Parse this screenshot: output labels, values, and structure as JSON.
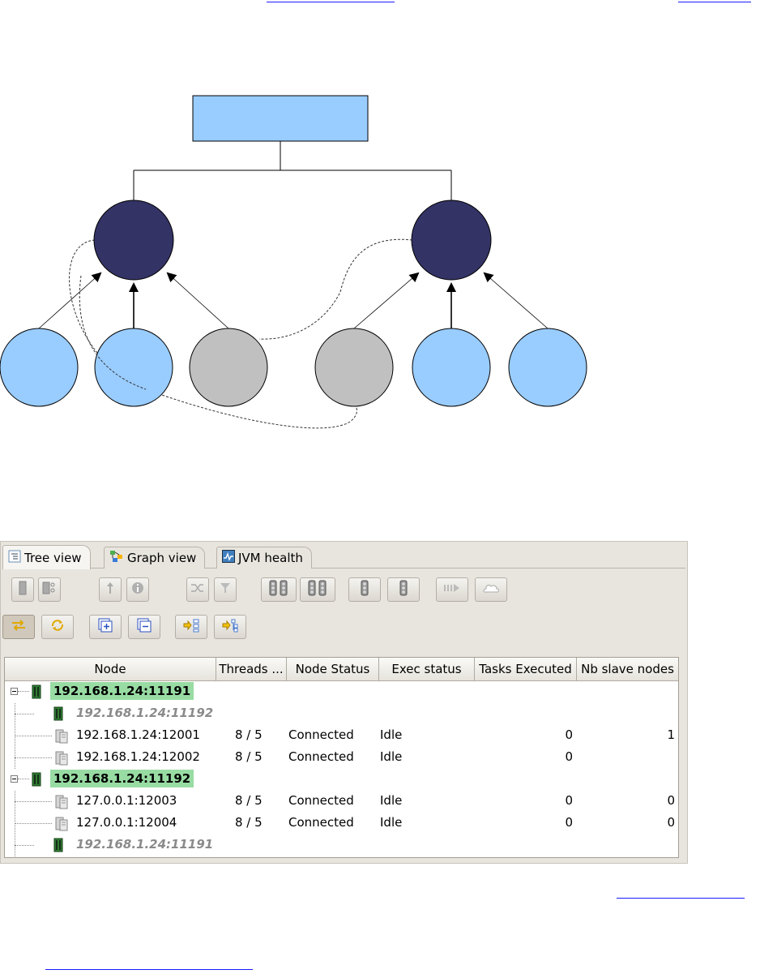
{
  "tabs": [
    {
      "label": "Tree view",
      "icon": "tree-view-icon",
      "active": true
    },
    {
      "label": "Graph view",
      "icon": "graph-view-icon",
      "active": false
    },
    {
      "label": "JVM health",
      "icon": "jvm-health-icon",
      "active": false
    }
  ],
  "toolbar": {
    "row1": [
      "server-icon",
      "server-settings-icon",
      "upload-icon",
      "info-icon",
      "shuffle-icon",
      "filter-icon",
      "traffic-light-pair-icon",
      "traffic-light-pair-icon",
      "traffic-light-icon",
      "traffic-light-icon",
      "play-forward-icon",
      "cloud-icon"
    ],
    "row2": [
      "swap-icon",
      "refresh-icon",
      "expand-all-icon",
      "collapse-all-icon",
      "select-drivers-icon",
      "select-nodes-icon"
    ]
  },
  "table": {
    "columns": [
      "Node",
      "Threads ...",
      "Node Status",
      "Exec status",
      "Tasks Executed",
      "Nb slave nodes"
    ],
    "rows": [
      {
        "level": 0,
        "kind": "driver",
        "name": "192.168.1.24:11191",
        "threads": "",
        "node_status": "",
        "exec_status": "",
        "tasks": "",
        "slaves": ""
      },
      {
        "level": 1,
        "kind": "peer",
        "name": "192.168.1.24:11192",
        "threads": "",
        "node_status": "",
        "exec_status": "",
        "tasks": "",
        "slaves": ""
      },
      {
        "level": 1,
        "kind": "node",
        "name": "192.168.1.24:12001",
        "threads": "8 / 5",
        "node_status": "Connected",
        "exec_status": "Idle",
        "tasks": "0",
        "slaves": "1"
      },
      {
        "level": 1,
        "kind": "node",
        "name": "192.168.1.24:12002",
        "threads": "8 / 5",
        "node_status": "Connected",
        "exec_status": "Idle",
        "tasks": "0",
        "slaves": ""
      },
      {
        "level": 0,
        "kind": "driver",
        "name": "192.168.1.24:11192",
        "threads": "",
        "node_status": "",
        "exec_status": "",
        "tasks": "",
        "slaves": ""
      },
      {
        "level": 1,
        "kind": "node",
        "name": "127.0.0.1:12003",
        "threads": "8 / 5",
        "node_status": "Connected",
        "exec_status": "Idle",
        "tasks": "0",
        "slaves": "0"
      },
      {
        "level": 1,
        "kind": "node",
        "name": "127.0.0.1:12004",
        "threads": "8 / 5",
        "node_status": "Connected",
        "exec_status": "Idle",
        "tasks": "0",
        "slaves": "0"
      },
      {
        "level": 1,
        "kind": "peer",
        "name": "192.168.1.24:11191",
        "threads": "",
        "node_status": "",
        "exec_status": "",
        "tasks": "",
        "slaves": ""
      }
    ]
  },
  "diagram": {
    "colors": {
      "box": "#99ccff",
      "driver": "#333366",
      "node": "#99ccff",
      "peer": "#c0c0c0"
    }
  }
}
